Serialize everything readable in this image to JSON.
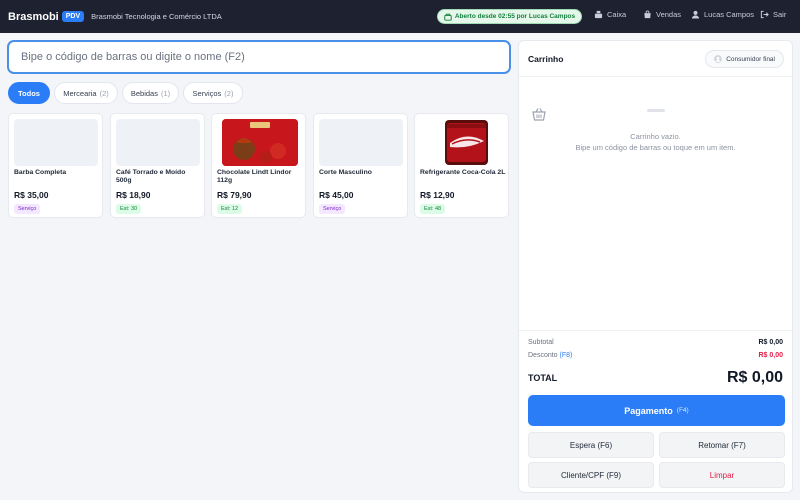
{
  "header": {
    "brand": "Brasmobi",
    "brand_badge": "PDV",
    "company": "Brasmobi Tecnologia e Comércio LTDA",
    "status": "Aberto desde 02:55 por Lucas Campos",
    "nav": {
      "cashier": "Caixa",
      "sales": "Vendas",
      "user": "Lucas Campos",
      "logout": "Sair"
    }
  },
  "search": {
    "placeholder": "Bipe o código de barras ou digite o nome (F2)"
  },
  "categories": [
    {
      "label": "Todos",
      "count": ""
    },
    {
      "label": "Mercearia",
      "count": "(2)"
    },
    {
      "label": "Bebidas",
      "count": "(1)"
    },
    {
      "label": "Serviços",
      "count": "(2)"
    }
  ],
  "products": [
    {
      "name": "Barba Completa",
      "price": "R$ 35,00",
      "badge": "Serviço",
      "badge_type": "service"
    },
    {
      "name": "Café Torrado e Moído 500g",
      "price": "R$ 18,90",
      "badge": "Est: 30",
      "badge_type": "stock"
    },
    {
      "name": "Chocolate Lindt Lindor 112g",
      "price": "R$ 79,90",
      "badge": "Est: 12",
      "badge_type": "stock"
    },
    {
      "name": "Corte Masculino",
      "price": "R$ 45,00",
      "badge": "Serviço",
      "badge_type": "service"
    },
    {
      "name": "Refrigerante Coca-Cola 2L",
      "price": "R$ 12,90",
      "badge": "Est: 48",
      "badge_type": "stock"
    }
  ],
  "cart": {
    "title": "Carrinho",
    "customer": "Consumidor final",
    "empty_line1": "Carrinho vazio.",
    "empty_line2": "Bipe um código de barras ou toque em um item.",
    "subtotal_label": "Subtotal",
    "subtotal_value": "R$ 0,00",
    "discount_label": "Desconto",
    "discount_key": "(F8)",
    "discount_value": "R$ 0,00",
    "total_label": "TOTAL",
    "total_value": "R$ 0,00"
  },
  "actions": {
    "pay_label": "Pagamento",
    "pay_key": "(F4)",
    "hold": "Espera (F6)",
    "resume": "Retomar (F7)",
    "customer": "Cliente/CPF (F9)",
    "clear": "Limpar"
  },
  "colors": {
    "topbar": "#1d2130",
    "accent": "#2b7cf7",
    "status_green": "#15803d",
    "danger": "#e11d48"
  }
}
